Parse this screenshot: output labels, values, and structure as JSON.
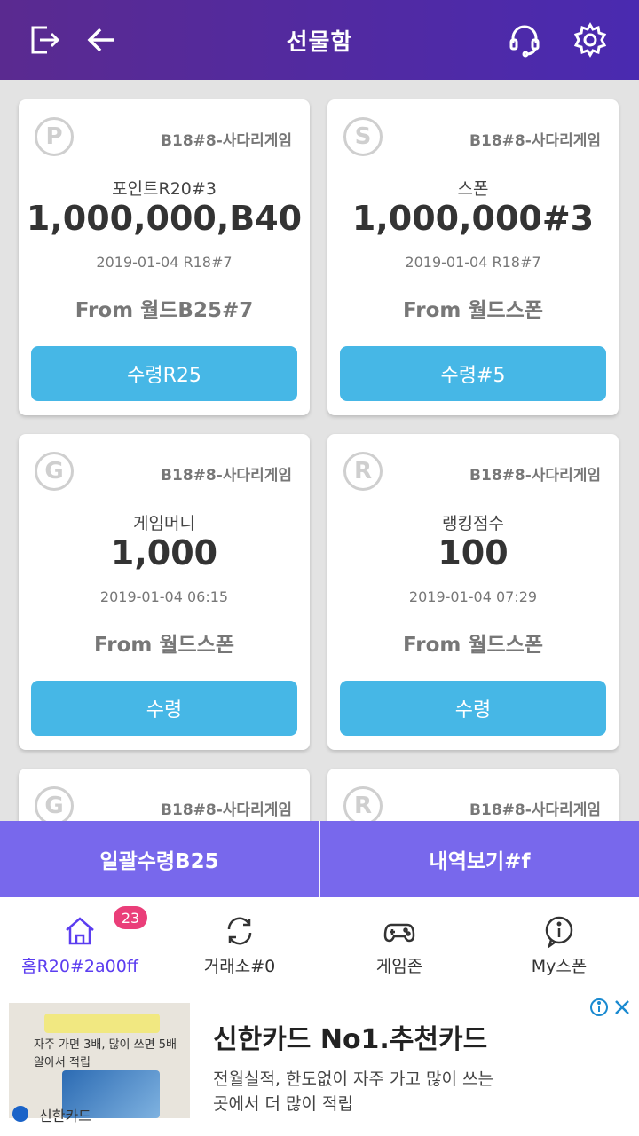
{
  "header": {
    "title": "선물함"
  },
  "cards": [
    {
      "badge": "P",
      "game": "B18#8-사다리게임",
      "type": "포인트R20#3",
      "amount": "1,000,000,B40",
      "date": "2019-01-04 R18#7",
      "from": "From 월드B25#7",
      "button": "수령R25"
    },
    {
      "badge": "S",
      "game": "B18#8-사다리게임",
      "type": "스폰",
      "amount": "1,000,000#3",
      "date": "2019-01-04 R18#7",
      "from": "From 월드스폰",
      "button": "수령#5"
    },
    {
      "badge": "G",
      "game": "B18#8-사다리게임",
      "type": "게임머니",
      "amount": "1,000",
      "date": "2019-01-04 06:15",
      "from": "From 월드스폰",
      "button": "수령"
    },
    {
      "badge": "R",
      "game": "B18#8-사다리게임",
      "type": "랭킹점수",
      "amount": "100",
      "date": "2019-01-04 07:29",
      "from": "From 월드스폰",
      "button": "수령"
    },
    {
      "badge": "G",
      "game": "B18#8-사다리게임"
    },
    {
      "badge": "R",
      "game": "B18#8-사다리게임"
    }
  ],
  "bulk": {
    "receive_all": "일괄수령B25",
    "history": "내역보기#f"
  },
  "tabs": [
    {
      "label": "홈R20#2a00ff",
      "badge": "23",
      "icon": "home-icon"
    },
    {
      "label": "거래소#0",
      "icon": "exchange-icon"
    },
    {
      "label": "게임존",
      "icon": "gamepad-icon"
    },
    {
      "label": "My스폰",
      "icon": "info-icon"
    }
  ],
  "ad": {
    "headline": "신한카드 No1.추천카드",
    "description": "전월실적, 한도없이 자주 가고 많이 쓰는 곳에서 더 많이 적립",
    "brand": "신한카드",
    "thumb_line1": "자주 가면 3배, 많이 쓰면 5배",
    "thumb_line2": "알아서 적립"
  },
  "colors": {
    "header_start": "#5a2a90",
    "header_end": "#4a2ab0",
    "button_blue": "#46b7e6",
    "bulk_purple": "#7868ec",
    "active_tab": "#5b3df0",
    "badge_pink": "#ea3e79"
  }
}
